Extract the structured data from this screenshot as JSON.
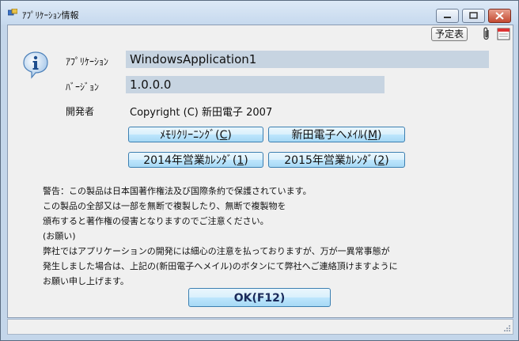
{
  "window": {
    "title": "ｱﾌﾟﾘｹｰｼｮﾝ情報"
  },
  "toolbar": {
    "schedule_label": "予定表"
  },
  "fields": {
    "application_label": "ｱﾌﾟﾘｹｰｼｮﾝ",
    "application_value": "WindowsApplication1",
    "version_label": "ﾊﾞｰｼﾞｮﾝ",
    "version_value": "1.0.0.0",
    "developer_label": "開発者",
    "developer_value": "Copyright (C) 新田電子 2007"
  },
  "buttons": {
    "memory_clean": {
      "text": "ﾒﾓﾘｸﾘｰﾆﾝｸﾞ(",
      "key": "C",
      "end": ")"
    },
    "mail": {
      "text": "新田電子へﾒｲﾙ(",
      "key": "M",
      "end": ")"
    },
    "cal2014": {
      "text": "2014年営業ｶﾚﾝﾀﾞ(",
      "key": "1",
      "end": ")"
    },
    "cal2015": {
      "text": "2015年営業ｶﾚﾝﾀﾞ(",
      "key": "2",
      "end": ")"
    },
    "ok": "OK(F12)"
  },
  "notice": [
    "警告：この製品は日本国著作権法及び国際条約で保護されています。",
    "この製品の全部又は一部を無断で複製したり、無断で複製物を",
    "頒布すると著作権の侵害となりますのでご注意ください。",
    "(お願い)",
    "弊社ではアプリケーションの開発には細心の注意を払っておりますが、万が一異常事態が",
    "発生しました場合は、上記の(新田電子へメイル)のボタンにて弊社へご連絡頂けますように",
    "お願い申し上げます。"
  ],
  "icons": {
    "app": "app-window-icon",
    "info": "info-balloon-icon",
    "clip": "paperclip-icon",
    "calendar": "calendar-icon"
  }
}
